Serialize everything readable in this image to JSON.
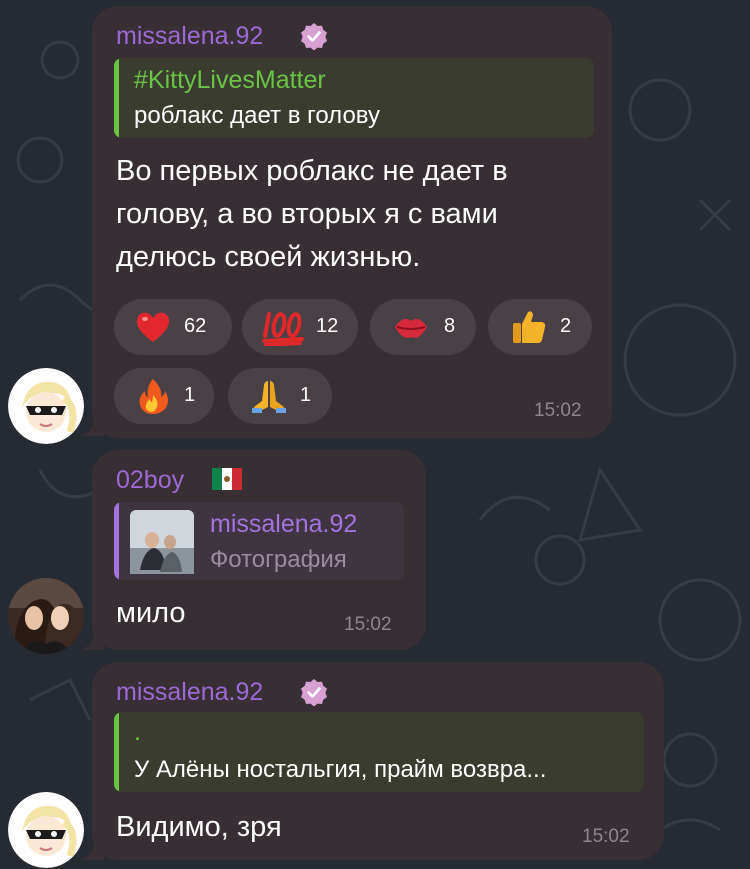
{
  "messages": [
    {
      "sender": "missalena.92",
      "reply_title": "#KittyLivesMatter",
      "reply_text": "роблакс дает в голову",
      "text_lines": [
        "Во первых роблакс не дает в",
        "голову, а во вторых я с вами",
        "делюсь своей жизнью."
      ],
      "time": "15:02",
      "reactions": [
        {
          "emoji": "red-heart",
          "count": "62"
        },
        {
          "emoji": "hundred-points",
          "count": "12"
        },
        {
          "emoji": "kiss-mark",
          "count": "8"
        },
        {
          "emoji": "thumbs-up",
          "count": "2"
        },
        {
          "emoji": "fire",
          "count": "1"
        },
        {
          "emoji": "folded-hands",
          "count": "1"
        }
      ]
    },
    {
      "sender": "02boy",
      "sender_flag": "mexico-flag",
      "reply_title": "missalena.92",
      "reply_text": "Фотография",
      "text": "мило",
      "time": "15:02"
    },
    {
      "sender": "missalena.92",
      "reply_title": ".",
      "reply_text": "У Алёны ностальгия, прайм возвра...",
      "text": "Видимо, зря",
      "time": "15:02"
    }
  ],
  "colors": {
    "background": "#262a33",
    "bubble": "#372f34",
    "sender_purple": "#9b6ad6",
    "quote_green": "#6cc445",
    "quote_green_bg": "#3b3c30",
    "quote_purple": "#a374e0",
    "quote_purple_bg": "#3f3540",
    "time": "#8f8690",
    "reaction_bg": "#4a4147"
  }
}
